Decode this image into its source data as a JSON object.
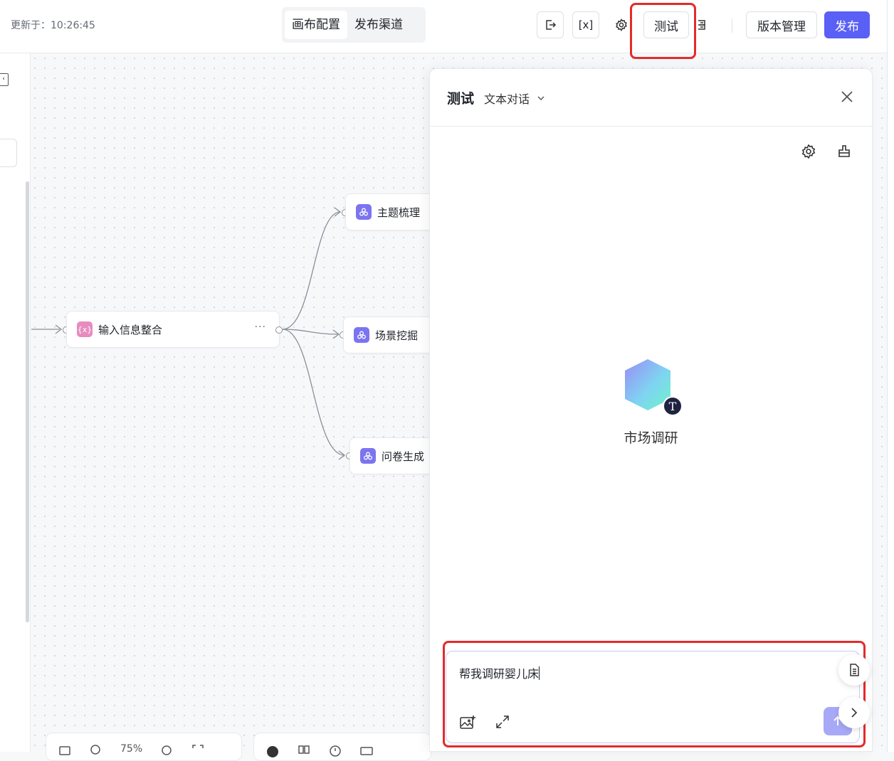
{
  "topbar": {
    "updated": "更新于：10:26:45",
    "tabs": [
      "画布配置",
      "发布渠道"
    ],
    "test_label": "测试",
    "version_label": "版本管理",
    "publish_label": "发布",
    "variable_icon_label": "[x]"
  },
  "canvas": {
    "nodes": [
      {
        "label": "输入信息整合",
        "icon_text": "{x}",
        "icon_color": "#e88bbf"
      },
      {
        "label": "主题梳理",
        "icon_color": "#7b74f0"
      },
      {
        "label": "场景挖掘",
        "icon_color": "#7b74f0"
      },
      {
        "label": "问卷生成",
        "icon_color": "#7b74f0"
      }
    ],
    "more": "···",
    "zoom": "75%"
  },
  "panel": {
    "title": "测试",
    "mode": "文本对话",
    "agent_name": "市场调研",
    "avatar_badge": "T",
    "input_value": "帮我调研婴儿床"
  },
  "colors": {
    "accent": "#5a5ff5",
    "highlight": "#e32b2b",
    "send_disabled": "#a7a9f7"
  }
}
